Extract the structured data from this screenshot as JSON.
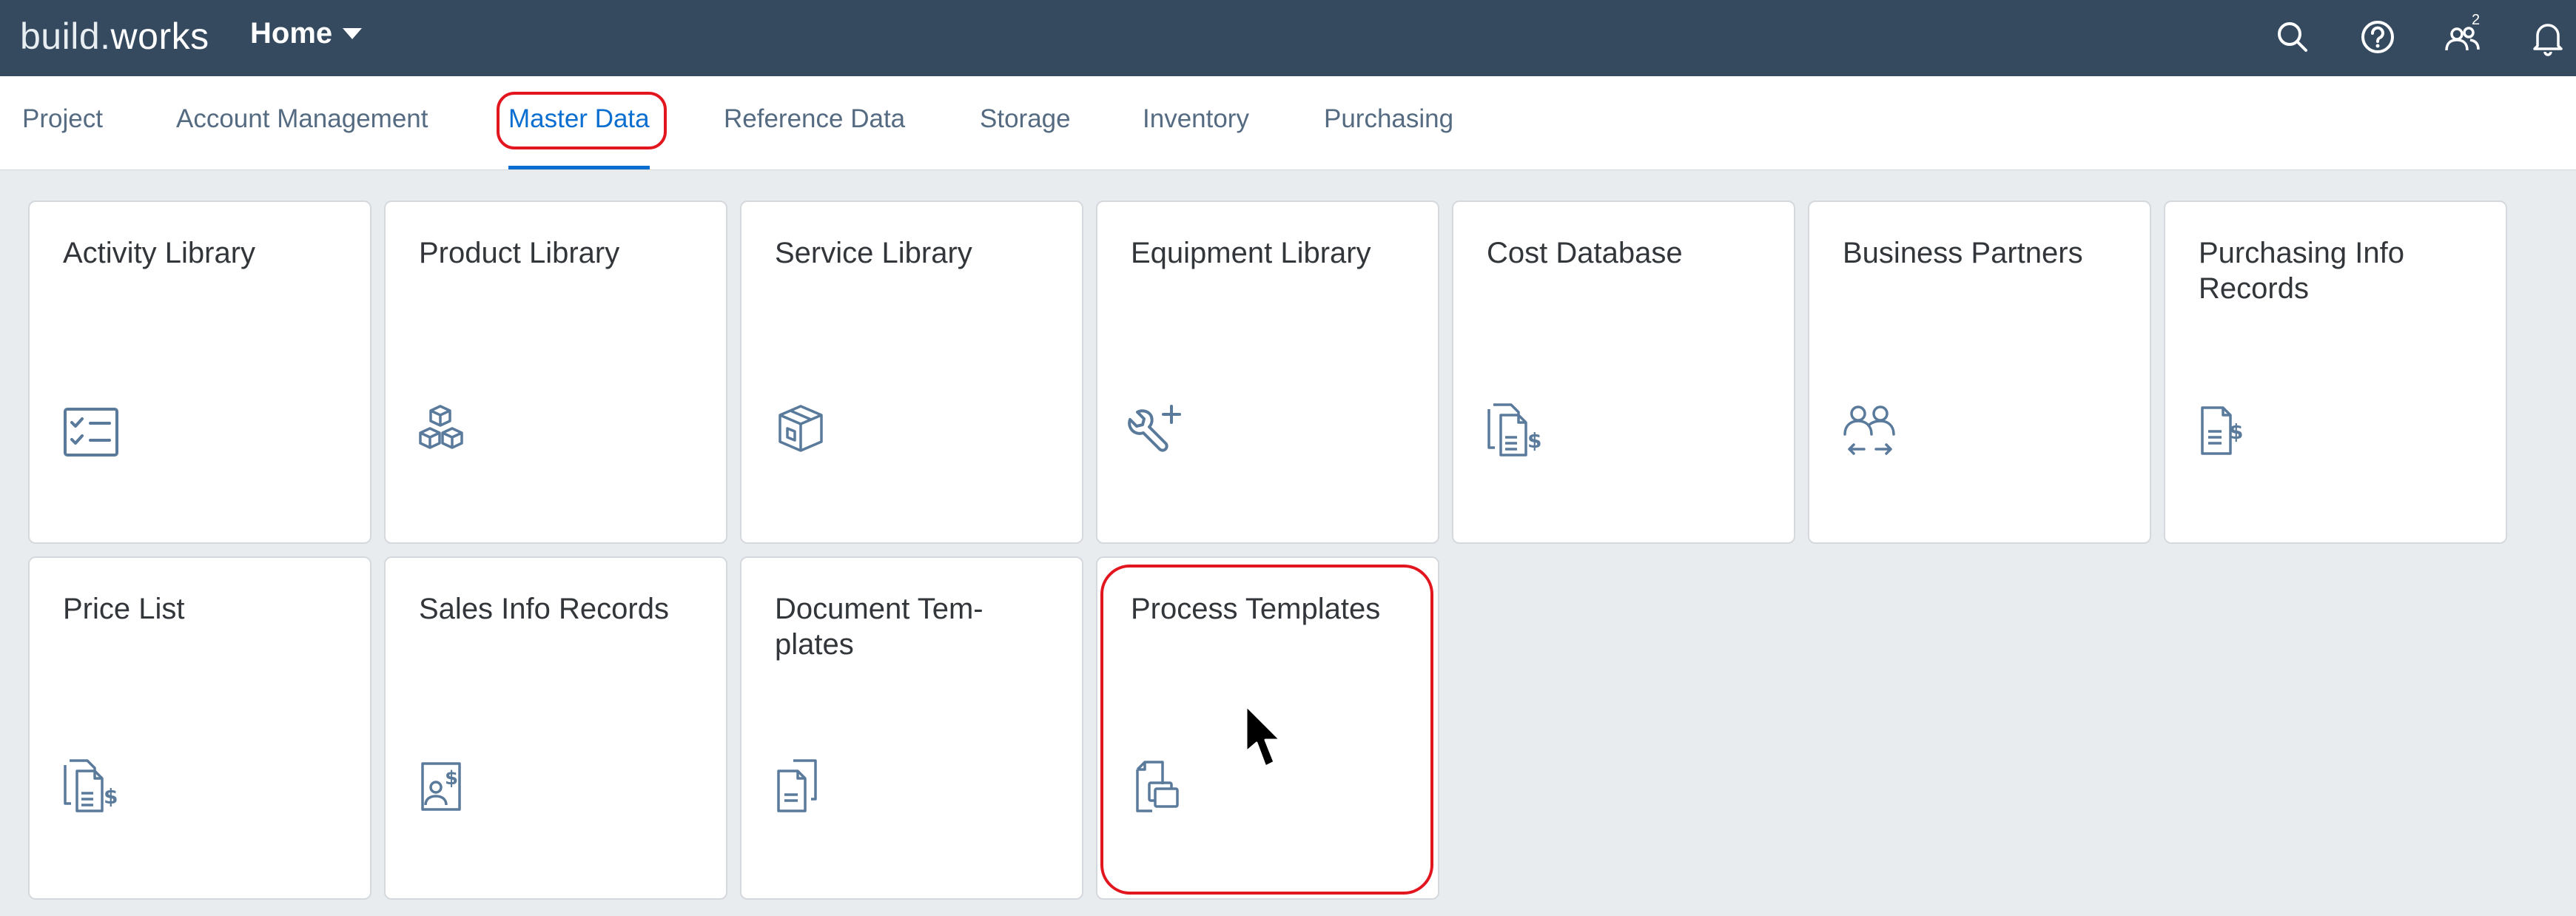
{
  "shell": {
    "logo_part1": "build.",
    "logo_part2": "works",
    "home_label": "Home",
    "notification_count": "2"
  },
  "tabs": [
    {
      "label": "Project"
    },
    {
      "label": "Account Management"
    },
    {
      "label": "Master Data",
      "active": true
    },
    {
      "label": "Reference Data"
    },
    {
      "label": "Storage"
    },
    {
      "label": "Inventory"
    },
    {
      "label": "Purchasing"
    }
  ],
  "tiles": [
    {
      "title": "Activity Library",
      "icon": "checklist-icon"
    },
    {
      "title": "Product Library",
      "icon": "cubes-icon"
    },
    {
      "title": "Service Library",
      "icon": "package-icon"
    },
    {
      "title": "Equipment Library",
      "icon": "wrench-add-icon"
    },
    {
      "title": "Cost Database",
      "icon": "documents-dollar-icon"
    },
    {
      "title": "Business Partners",
      "icon": "people-exchange-icon"
    },
    {
      "title": "Purchasing Info Records",
      "icon": "document-dollar-icon"
    },
    {
      "title": "Price List",
      "icon": "documents-dollar-icon"
    },
    {
      "title": "Sales Info Records",
      "icon": "person-document-dollar-icon"
    },
    {
      "title": "Document Tem-plates",
      "icon": "documents-icon"
    },
    {
      "title": "Process Templates",
      "icon": "document-copy-icon"
    }
  ],
  "colors": {
    "shell_bg": "#354a5f",
    "accent": "#0a6ed1",
    "icon": "#5a7a9b",
    "highlight": "#e2161e"
  }
}
